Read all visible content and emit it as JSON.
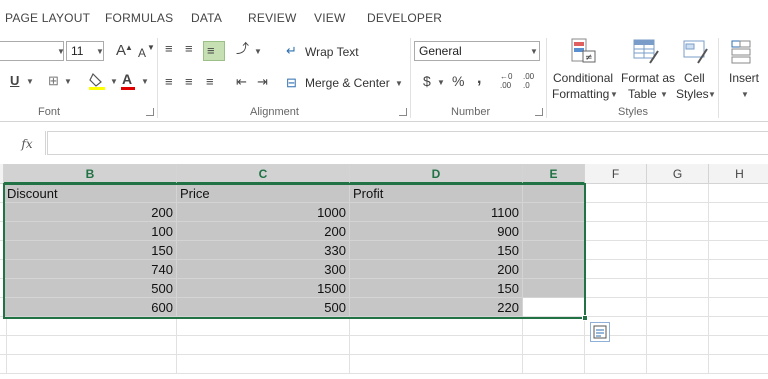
{
  "ribbon_tabs": [
    "PAGE LAYOUT",
    "FORMULAS",
    "DATA",
    "REVIEW",
    "VIEW",
    "DEVELOPER"
  ],
  "font": {
    "size": "11",
    "grow_label": "A",
    "shrink_label": "A",
    "underline": "U",
    "group_label": "Font",
    "highlight_color": "#ffff00",
    "font_color": "#e00000"
  },
  "alignment": {
    "wrap_text": "Wrap Text",
    "merge_center": "Merge & Center",
    "group_label": "Alignment"
  },
  "number": {
    "format": "General",
    "currency": "$",
    "percent": "%",
    "comma": ",",
    "inc_decimal": ".00",
    "dec_decimal": ".0",
    "group_label": "Number"
  },
  "styles": {
    "conditional_1": "Conditional",
    "conditional_2": "Formatting",
    "format_as_1": "Format as",
    "format_as_2": "Table",
    "cell_styles_1": "Cell",
    "cell_styles_2": "Styles",
    "group_label": "Styles"
  },
  "cells_group": {
    "insert": "Insert"
  },
  "formula_bar": {
    "fx": "fx",
    "value": ""
  },
  "columns": [
    "B",
    "C",
    "D",
    "E",
    "F",
    "G",
    "H"
  ],
  "table": {
    "headers": [
      "Discount",
      "Price",
      "Profit"
    ],
    "rows": [
      [
        "200",
        "1000",
        "1100"
      ],
      [
        "100",
        "200",
        "900"
      ],
      [
        "150",
        "330",
        "150"
      ],
      [
        "740",
        "300",
        "200"
      ],
      [
        "500",
        "1500",
        "150"
      ],
      [
        "600",
        "500",
        "220"
      ]
    ]
  },
  "accent_color": "#217346"
}
